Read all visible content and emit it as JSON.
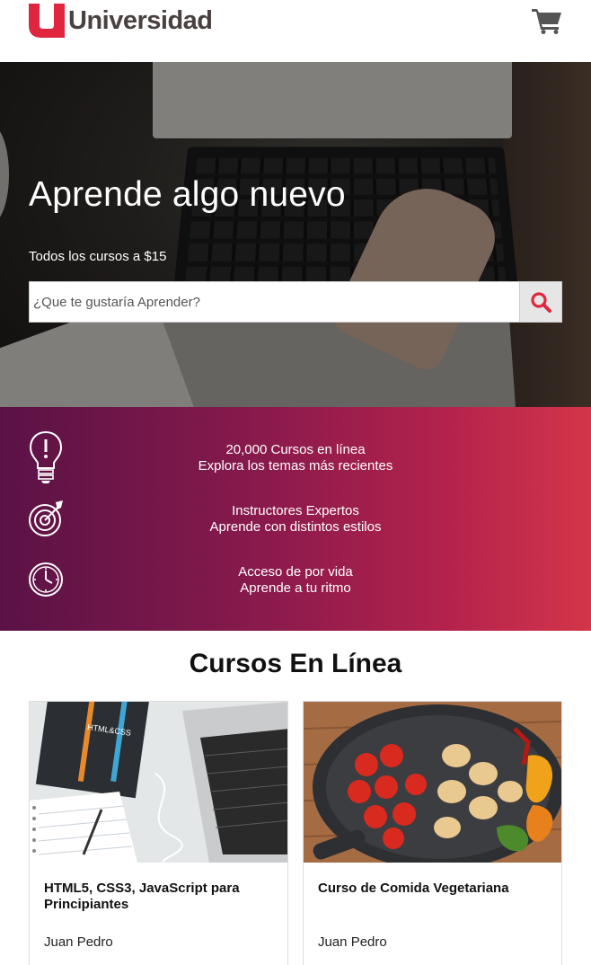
{
  "header": {
    "logo_text": "Universidad",
    "logo_letter": "U",
    "cart_icon": "shopping-cart-icon",
    "brand_color": "#e0263f"
  },
  "hero": {
    "title": "Aprende algo nuevo",
    "subtitle": "Todos los cursos a $15",
    "search": {
      "placeholder": "¿Que te gustaría Aprender?",
      "value": "",
      "button_icon": "search-icon"
    }
  },
  "features": [
    {
      "icon": "lightbulb-icon",
      "line1": "20,000 Cursos en línea",
      "line2": "Explora los temas más recientes"
    },
    {
      "icon": "target-icon",
      "line1": "Instructores Expertos",
      "line2": "Aprende con distintos estilos"
    },
    {
      "icon": "clock-icon",
      "line1": "Acceso de por vida",
      "line2": "Aprende a tu ritmo"
    }
  ],
  "courses": {
    "title": "Cursos En Línea",
    "items": [
      {
        "title": "HTML5, CSS3, JavaScript para Principiantes",
        "author": "Juan Pedro",
        "image": "laptop-html-css-book"
      },
      {
        "title": "Curso de Comida Vegetariana",
        "author": "Juan Pedro",
        "image": "vegetables-pan"
      }
    ]
  }
}
